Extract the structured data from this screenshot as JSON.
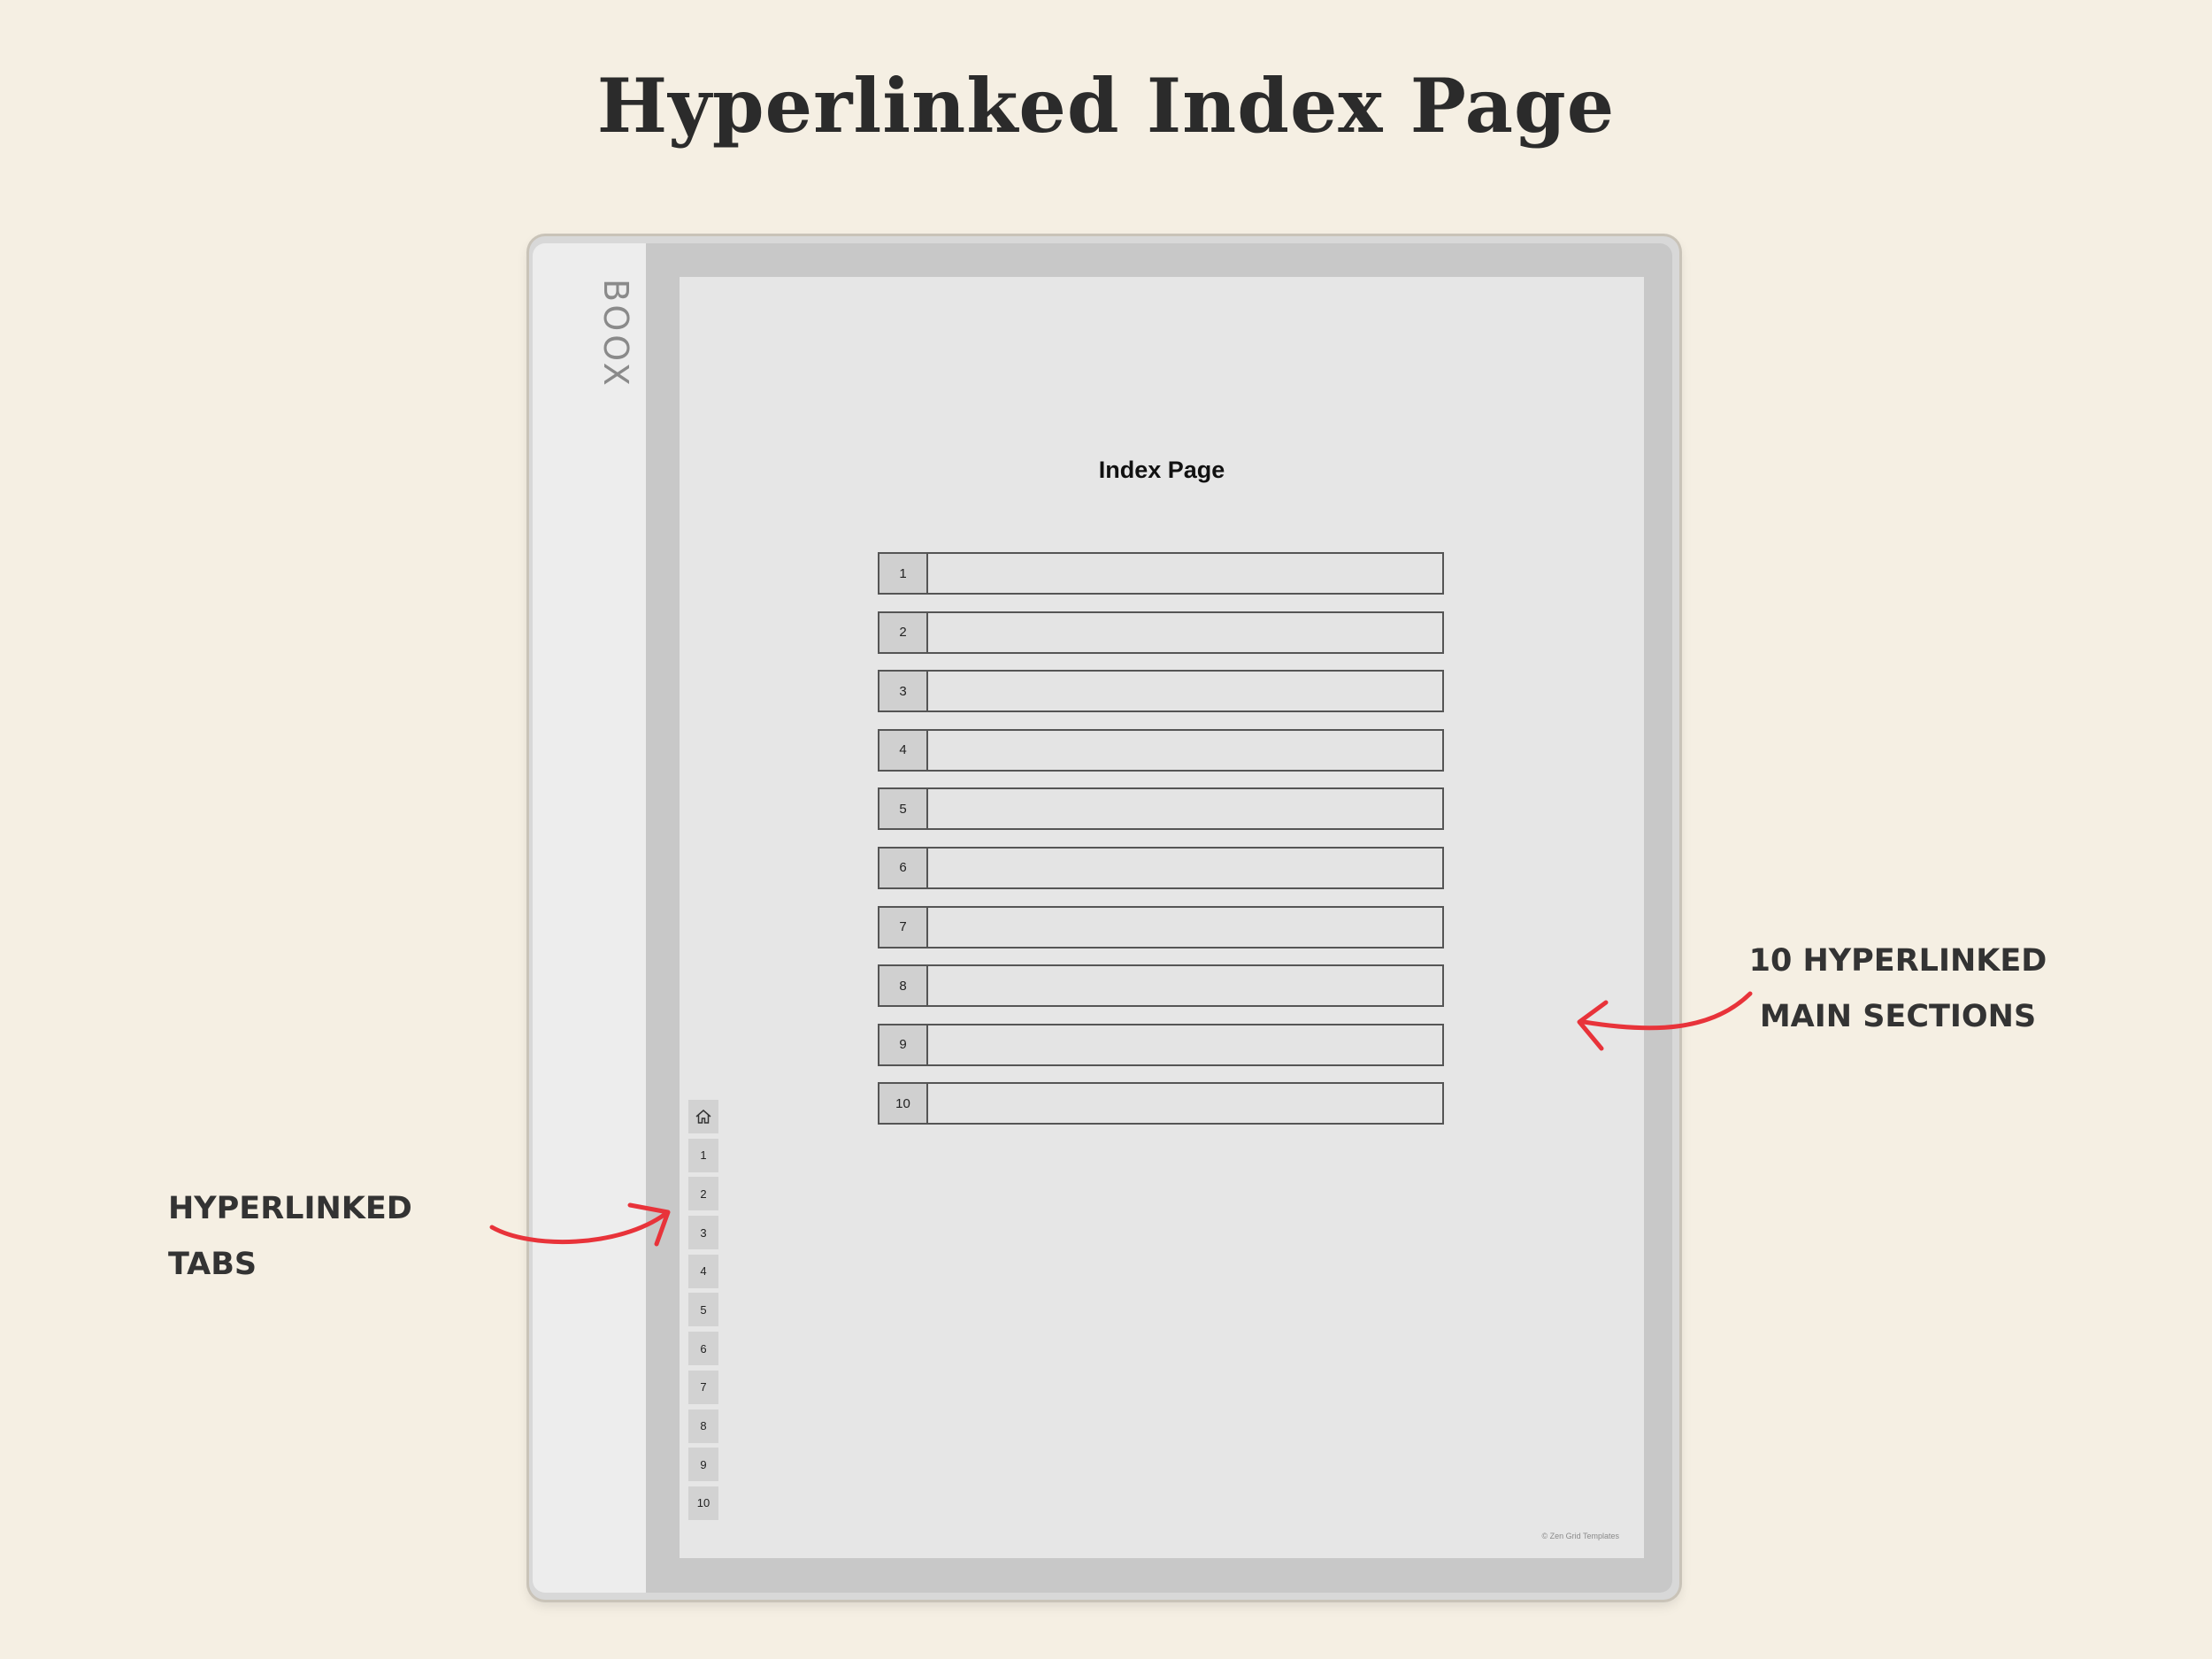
{
  "headline": "Hyperlinked Index Page",
  "device": {
    "brand": "BOOX"
  },
  "screen": {
    "title": "Index Page",
    "index_rows": [
      "1",
      "2",
      "3",
      "4",
      "5",
      "6",
      "7",
      "8",
      "9",
      "10"
    ],
    "tabs": [
      "1",
      "2",
      "3",
      "4",
      "5",
      "6",
      "7",
      "8",
      "9",
      "10"
    ],
    "home_icon": "home-icon",
    "copyright": "© Zen Grid Templates"
  },
  "callouts": {
    "sections_line1": "10 HYPERLINKED",
    "sections_line2": "MAIN SECTIONS",
    "tabs": "HYPERLINKED TABS"
  },
  "colors": {
    "background": "#f5efe3",
    "arrow": "#e8333a"
  }
}
